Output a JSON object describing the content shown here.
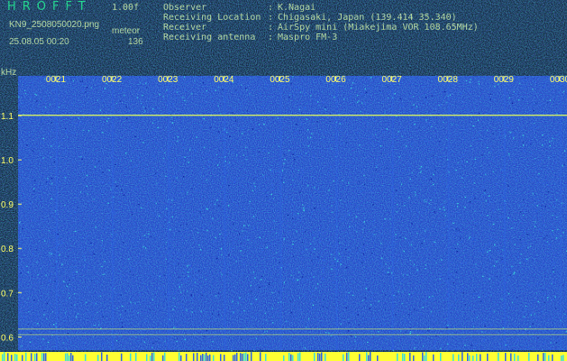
{
  "header": {
    "brand": "HROFFT",
    "version": "1.00f",
    "filename": "KN9_2508050020.png",
    "mode": "meteor",
    "datetime": "25.08.05 00:20",
    "count": "136",
    "info": [
      {
        "key": "Observer",
        "sep": ":",
        "value": "K.Nagai"
      },
      {
        "key": "Receiving Location",
        "sep": ":",
        "value": "Chigasaki, Japan (139.414 35.340)"
      },
      {
        "key": "Receiver",
        "sep": ":",
        "value": "AirSpy mini (Miakejima VOR 108.65MHz)"
      },
      {
        "key": "Receiving antenna",
        "sep": ":",
        "value": "Maspro FM-3"
      }
    ]
  },
  "chart_data": {
    "type": "heatmap",
    "ylabel": "kHz",
    "yticks": [
      "1.1",
      "1.0",
      "0.9",
      "0.8",
      "0.7",
      "0.6"
    ],
    "xticks": [
      "0021",
      "0022",
      "0023",
      "0024",
      "0025",
      "0026",
      "0027",
      "0028",
      "0029",
      "0030"
    ],
    "ylim": [
      0.57,
      1.19
    ],
    "carrier_lines_khz": [
      1.101,
      0.605,
      0.618
    ],
    "colors": {
      "background": "#1428b4",
      "noise_low": "#0a1e9a",
      "noise_mid": "#2d64e6",
      "noise_high": "#3cdcdc",
      "carrier": "#e6ff5a",
      "bottom_bar": "#ffff33",
      "text": "#ffff66",
      "brand": "#00ff44"
    }
  }
}
